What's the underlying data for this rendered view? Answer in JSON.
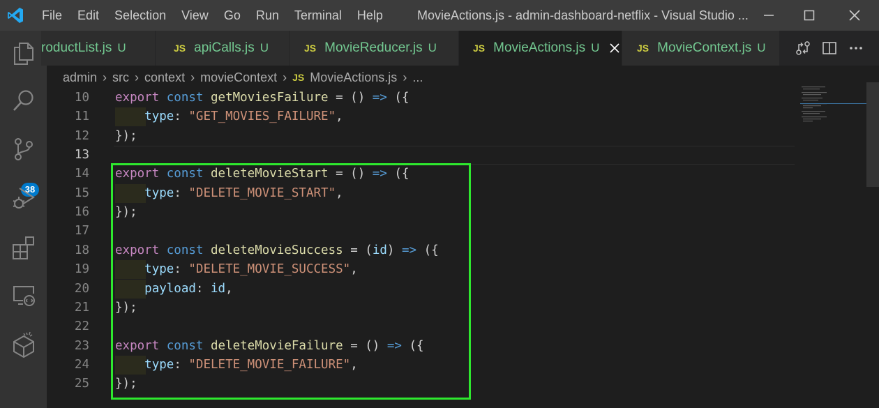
{
  "window": {
    "title": "MovieActions.js - admin-dashboard-netflix - Visual Studio ..."
  },
  "menu": [
    "File",
    "Edit",
    "Selection",
    "View",
    "Go",
    "Run",
    "Terminal",
    "Help"
  ],
  "activity_bar": {
    "items": [
      "explorer-icon",
      "search-icon",
      "source-control-icon",
      "run-debug-icon",
      "extensions-icon",
      "remote-explorer-icon",
      "docker-icon"
    ],
    "source_control_badge": "38"
  },
  "tabs": [
    {
      "icon": "JS",
      "label": "roductList.js",
      "status": "U",
      "active": false
    },
    {
      "icon": "JS",
      "label": "apiCalls.js",
      "status": "U",
      "active": false
    },
    {
      "icon": "JS",
      "label": "MovieReducer.js",
      "status": "U",
      "active": false
    },
    {
      "icon": "JS",
      "label": "MovieActions.js",
      "status": "U",
      "active": true
    },
    {
      "icon": "JS",
      "label": "MovieContext.js",
      "status": "U",
      "active": false
    }
  ],
  "breadcrumb": {
    "items": [
      "admin",
      "src",
      "context",
      "movieContext"
    ],
    "file_icon": "JS",
    "file": "MovieActions.js",
    "trailing": "..."
  },
  "editor": {
    "current_line": 13,
    "lines": [
      {
        "num": "10",
        "tokens": [
          [
            "kw",
            "export"
          ],
          [
            "pu",
            " "
          ],
          [
            "st",
            "const"
          ],
          [
            "pu",
            " "
          ],
          [
            "fn",
            "getMoviesFailure"
          ],
          [
            "pu",
            " = () "
          ],
          [
            "ar",
            "=>"
          ],
          [
            "pu",
            " ({"
          ]
        ]
      },
      {
        "num": "11",
        "indent": true,
        "tokens": [
          [
            "pr",
            "type"
          ],
          [
            "pu",
            ": "
          ],
          [
            "sg",
            "\"GET_MOVIES_FAILURE\""
          ],
          [
            "pu",
            ","
          ]
        ]
      },
      {
        "num": "12",
        "tokens": [
          [
            "pu",
            "});"
          ]
        ]
      },
      {
        "num": "13",
        "tokens": []
      },
      {
        "num": "14",
        "tokens": [
          [
            "kw",
            "export"
          ],
          [
            "pu",
            " "
          ],
          [
            "st",
            "const"
          ],
          [
            "pu",
            " "
          ],
          [
            "fn",
            "deleteMovieStart"
          ],
          [
            "pu",
            " = () "
          ],
          [
            "ar",
            "=>"
          ],
          [
            "pu",
            " ({"
          ]
        ]
      },
      {
        "num": "15",
        "indent": true,
        "tokens": [
          [
            "pr",
            "type"
          ],
          [
            "pu",
            ": "
          ],
          [
            "sg",
            "\"DELETE_MOVIE_START\""
          ],
          [
            "pu",
            ","
          ]
        ]
      },
      {
        "num": "16",
        "tokens": [
          [
            "pu",
            "});"
          ]
        ]
      },
      {
        "num": "17",
        "tokens": []
      },
      {
        "num": "18",
        "tokens": [
          [
            "kw",
            "export"
          ],
          [
            "pu",
            " "
          ],
          [
            "st",
            "const"
          ],
          [
            "pu",
            " "
          ],
          [
            "fn",
            "deleteMovieSuccess"
          ],
          [
            "pu",
            " = ("
          ],
          [
            "pr",
            "id"
          ],
          [
            "pu",
            ") "
          ],
          [
            "ar",
            "=>"
          ],
          [
            "pu",
            " ({"
          ]
        ]
      },
      {
        "num": "19",
        "indent": true,
        "tokens": [
          [
            "pr",
            "type"
          ],
          [
            "pu",
            ": "
          ],
          [
            "sg",
            "\"DELETE_MOVIE_SUCCESS\""
          ],
          [
            "pu",
            ","
          ]
        ]
      },
      {
        "num": "20",
        "indent": true,
        "tokens": [
          [
            "pr",
            "payload"
          ],
          [
            "pu",
            ": "
          ],
          [
            "pr",
            "id"
          ],
          [
            "pu",
            ","
          ]
        ]
      },
      {
        "num": "21",
        "tokens": [
          [
            "pu",
            "});"
          ]
        ]
      },
      {
        "num": "22",
        "tokens": []
      },
      {
        "num": "23",
        "tokens": [
          [
            "kw",
            "export"
          ],
          [
            "pu",
            " "
          ],
          [
            "st",
            "const"
          ],
          [
            "pu",
            " "
          ],
          [
            "fn",
            "deleteMovieFailure"
          ],
          [
            "pu",
            " = () "
          ],
          [
            "ar",
            "=>"
          ],
          [
            "pu",
            " ({"
          ]
        ]
      },
      {
        "num": "24",
        "indent": true,
        "tokens": [
          [
            "pr",
            "type"
          ],
          [
            "pu",
            ": "
          ],
          [
            "sg",
            "\"DELETE_MOVIE_FAILURE\""
          ],
          [
            "pu",
            ","
          ]
        ]
      },
      {
        "num": "25",
        "tokens": [
          [
            "pu",
            "});"
          ]
        ]
      }
    ]
  },
  "colors": {
    "accent": "#007acc",
    "highlight_box": "#2ee82e",
    "untracked_file": "#73c991",
    "js_icon": "#cbcb41"
  }
}
